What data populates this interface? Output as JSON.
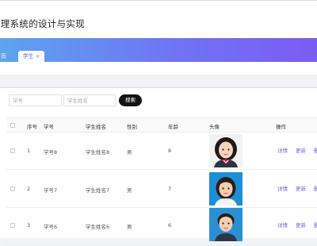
{
  "app": {
    "title": "管理系统的设计与实现"
  },
  "tabs": {
    "home_label": "首页",
    "active_label": "学生",
    "close_symbol": "×"
  },
  "search": {
    "id_placeholder": "学号",
    "name_placeholder": "学生姓名",
    "button_label": "搜索"
  },
  "table": {
    "headers": {
      "index": "序号",
      "student_id": "学号",
      "student_name": "学生姓名",
      "gender": "性别",
      "age": "年龄",
      "avatar": "头像",
      "actions": "操作"
    },
    "rows": [
      {
        "index": "1",
        "student_id": "学号8",
        "student_name": "学生姓名8",
        "gender": "男",
        "age": "8",
        "avatar": "girl-photo"
      },
      {
        "index": "2",
        "student_id": "学号7",
        "student_name": "学生姓名7",
        "gender": "男",
        "age": "7",
        "avatar": "girl-photo-blue"
      },
      {
        "index": "3",
        "student_id": "学号6",
        "student_name": "学生姓名6",
        "gender": "男",
        "age": "6",
        "avatar": "boy-photo-blue"
      }
    ],
    "actions": {
      "detail": "详情",
      "update": "更新",
      "delete": "删"
    }
  },
  "colors": {
    "accent": "#7b5cf3",
    "banner_start": "#5da4ee",
    "banner_end": "#7b5cf3"
  }
}
